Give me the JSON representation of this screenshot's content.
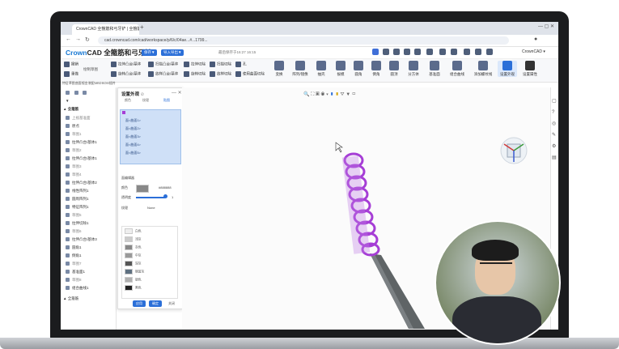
{
  "browser": {
    "tab_title": "CrownCAD 全箍筋和弓牙铲 | 全箍筋",
    "url": "cad.crowncad.com/cad/workspace/p/6/c/04ae...#...1799..."
  },
  "app": {
    "brand_prefix": "Crown",
    "brand_suffix": "CAD",
    "doc_title": "全箍筋和弓牙铲",
    "pill_1": "保存▼",
    "pill_2": "导入导出▼",
    "save_status": "最后保存于16:27 16:15",
    "user": "CrownCAD ▾"
  },
  "toolbar": {
    "items_row1": [
      "撤销",
      "拉伸凸台/基体",
      "扫描凸台/基体",
      "拉伸切除",
      "扫描切除",
      "孔"
    ],
    "items_row2": [
      "重做",
      "旋转凸台/基体",
      "放样凸台/基体",
      "旋转切除",
      "放样切除",
      "使用曲面切除"
    ],
    "group_label": "绘制草图",
    "big_buttons": [
      "变换",
      "阵列/镜像",
      "抽壳",
      "拔模",
      "圆角",
      "倒角",
      "圆顶",
      "分方体",
      "基准面",
      "组合曲线",
      "添加螺纹线",
      "设置外观",
      "设置属性"
    ],
    "mini_tabs": [
      "特征",
      "草图",
      "曲面",
      "钣金",
      "装配",
      "MBD",
      "BOM",
      "插件",
      "渲染"
    ]
  },
  "tree": {
    "root": "全箍筋",
    "items": [
      "上视基准面",
      "原点",
      "草图1",
      "拉伸凸台/基体1",
      "草图2",
      "拉伸凸台/基体1",
      "草图3",
      "草图4",
      "拉伸凸台/基体2",
      "线性阵列1",
      "圆周阵列1",
      "特征阵列1",
      "草图5",
      "拉伸切除1",
      "草图6",
      "拉伸凸台/基体3",
      "圆角1",
      "倒角1",
      "草图7",
      "基准面1",
      "草图8",
      "组合曲线1",
      "全箍筋"
    ]
  },
  "appearance": {
    "title": "设置外观",
    "tabs": [
      "颜色",
      "纹理",
      "贴图"
    ],
    "face_rows": [
      "面<曲面1>",
      "面<曲面2>",
      "面<曲面3>",
      "面<曲面4>",
      "面<曲面5>"
    ],
    "section_label": "面编辑器",
    "color_label": "颜色",
    "color_value": "#888888",
    "opacity_label": "透明度",
    "opacity_value": "1",
    "texture_label": "纹理",
    "texture_value": "None",
    "palette": [
      {
        "name": "白色",
        "hex": "#eeeeee"
      },
      {
        "name": "浅灰",
        "hex": "#cccccc"
      },
      {
        "name": "灰色",
        "hex": "#888888"
      },
      {
        "name": "中灰",
        "hex": "#999999"
      },
      {
        "name": "深灰",
        "hex": "#555555"
      },
      {
        "name": "钢蓝灰",
        "hex": "#5e7080"
      },
      {
        "name": "银色",
        "hex": "#b0b0b0"
      },
      {
        "name": "黑色",
        "hex": "#222222"
      }
    ],
    "ok": "应用",
    "apply": "确定",
    "cancel": "关闭"
  },
  "colors": {
    "accent": "#2b6fd8",
    "selection": "#a63ed6",
    "rod": "#5f6466"
  }
}
